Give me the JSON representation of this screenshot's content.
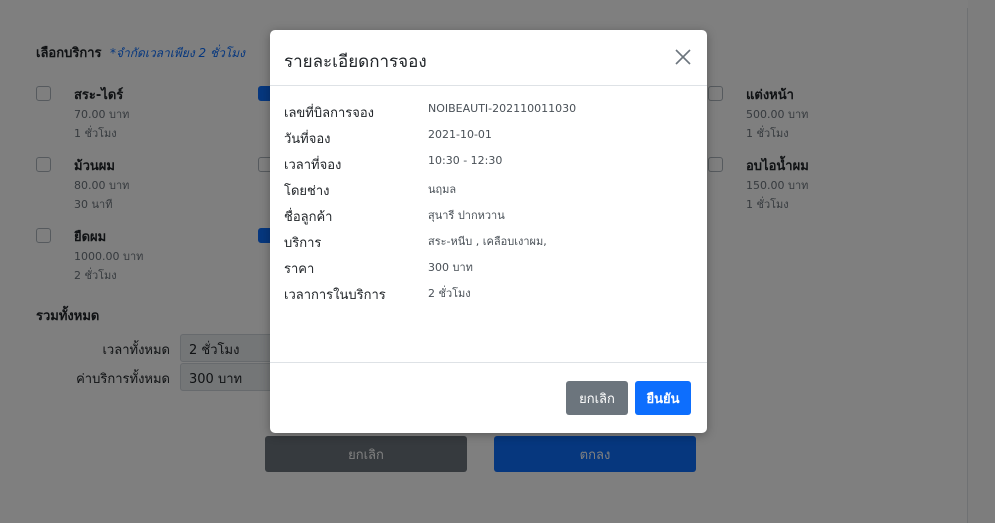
{
  "services": {
    "header": "เลือกบริการ",
    "note": "*จำกัดเวลาเพียง 2 ชั่วโมง",
    "items": [
      {
        "name": "สระ-ไดร์",
        "price": "70.00 บาท",
        "duration": "1 ชั่วโมง",
        "checked": false
      },
      {
        "name": "ม้วนผม",
        "price": "80.00 บาท",
        "duration": "30 นาที",
        "checked": false
      },
      {
        "name": "ยืดผม",
        "price": "1000.00 บาท",
        "duration": "2 ชั่วโมง",
        "checked": false
      },
      {
        "name": "แต่งหน้า",
        "price": "500.00 บาท",
        "duration": "1 ชั่วโมง",
        "checked": false
      },
      {
        "name": "อบไอน้ำผม",
        "price": "150.00 บาท",
        "duration": "1 ชั่วโมง",
        "checked": false
      }
    ]
  },
  "summary": {
    "title": "รวมทั้งหมด",
    "total_time_label": "เวลาทั้งหมด",
    "total_time_value": "2 ชั่วโมง",
    "total_price_label": "ค่าบริการทั้งหมด",
    "total_price_value": "300 บาท"
  },
  "page_buttons": {
    "cancel": "ยกเลิก",
    "ok": "ตกลง"
  },
  "modal": {
    "title": "รายละเอียดการจอง",
    "rows": [
      {
        "label": "เลขที่บิลการจอง",
        "value": "NOIBEAUTI-202110011030"
      },
      {
        "label": "วันที่จอง",
        "value": "2021-10-01"
      },
      {
        "label": "เวลาที่จอง",
        "value": "10:30 - 12:30"
      },
      {
        "label": "โดยช่าง",
        "value": "นฤมล"
      },
      {
        "label": "ชื่อลูกค้า",
        "value": "สุนารี ปากหวาน"
      },
      {
        "label": "บริการ",
        "value": "สระ-หนีบ , เคลือบเงาผม,"
      },
      {
        "label": "ราคา",
        "value": "300 บาท"
      },
      {
        "label": "เวลาการในบริการ",
        "value": "2 ชั่วโมง"
      }
    ],
    "cancel_label": "ยกเลิก",
    "confirm_label": "ยืนยัน"
  },
  "colors": {
    "primary": "#0d6efd",
    "secondary": "#6c757d"
  }
}
